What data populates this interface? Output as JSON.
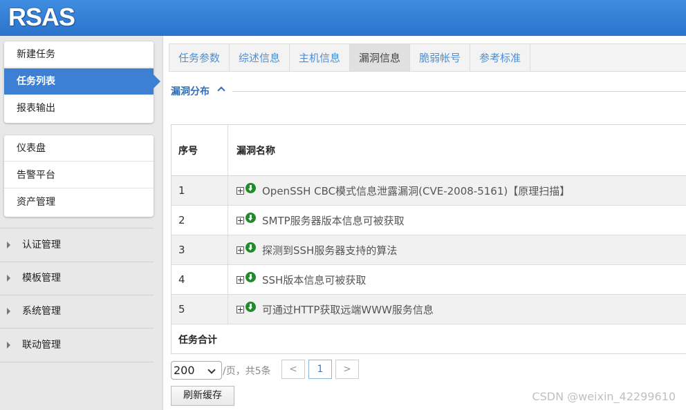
{
  "app": {
    "logo": "RSAS"
  },
  "sidebar": {
    "box1": [
      "新建任务",
      "任务列表",
      "报表输出"
    ],
    "box2": [
      "仪表盘",
      "告警平台",
      "资产管理"
    ],
    "groups": [
      "认证管理",
      "模板管理",
      "系统管理",
      "联动管理"
    ]
  },
  "tabs": [
    "任务参数",
    "综述信息",
    "主机信息",
    "漏洞信息",
    "脆弱帐号",
    "参考标准"
  ],
  "section": {
    "title": "漏洞分布"
  },
  "table": {
    "headers": {
      "no": "序号",
      "name": "漏洞名称"
    },
    "rows": [
      {
        "no": "1",
        "name": "OpenSSH CBC模式信息泄露漏洞(CVE-2008-5161)【原理扫描】"
      },
      {
        "no": "2",
        "name": "SMTP服务器版本信息可被获取"
      },
      {
        "no": "3",
        "name": "探测到SSH服务器支持的算法"
      },
      {
        "no": "4",
        "name": "SSH版本信息可被获取"
      },
      {
        "no": "5",
        "name": "可通过HTTP获取远端WWW服务信息"
      }
    ],
    "footer": "任务合计"
  },
  "pagination": {
    "page_size": "200",
    "summary": "/页，共5条",
    "prev": "<",
    "current": "1",
    "next": ">"
  },
  "buttons": {
    "refresh": "刷新缓存"
  },
  "watermark": "CSDN @weixin_42299610"
}
